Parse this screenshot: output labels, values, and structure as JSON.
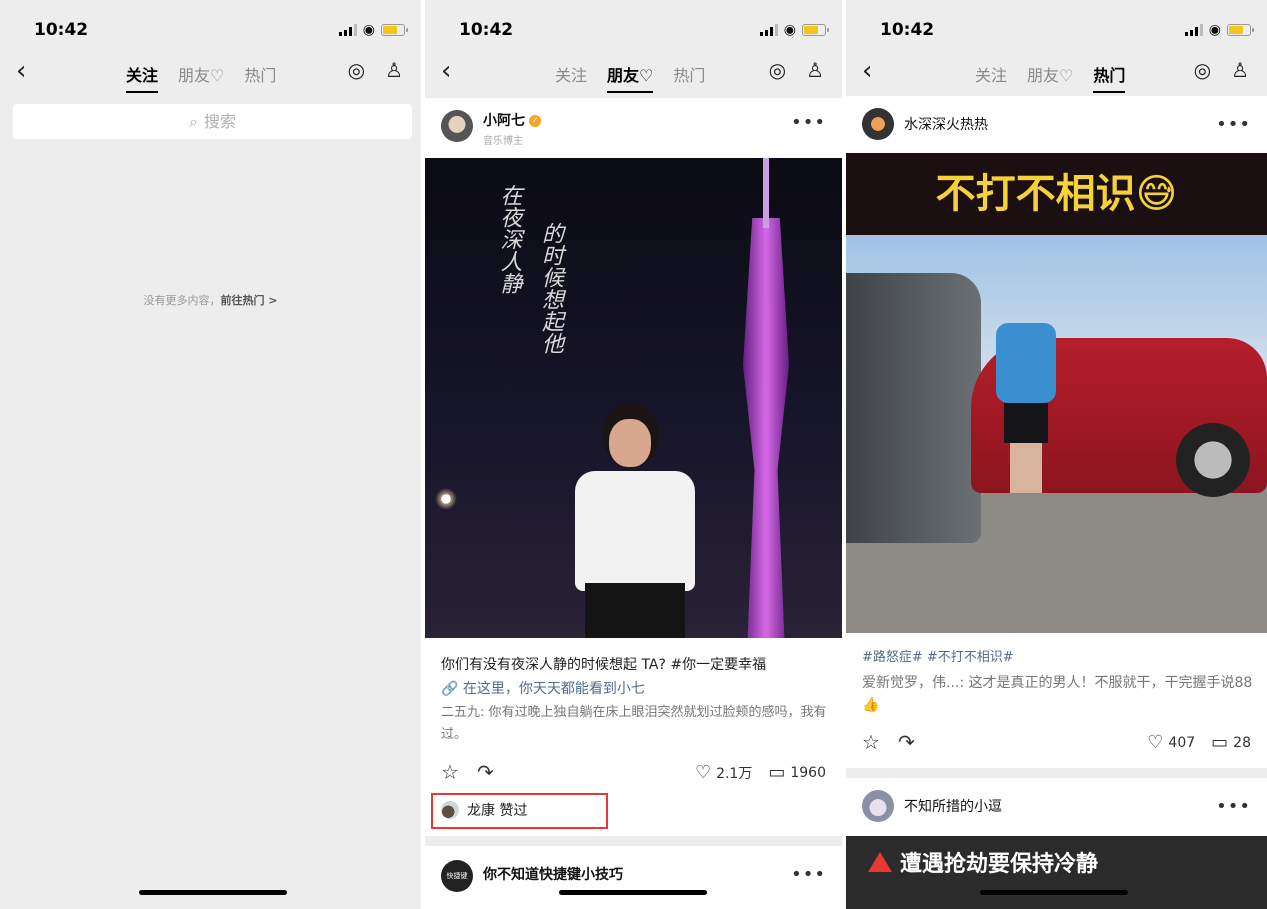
{
  "status": {
    "time": "10:42"
  },
  "nav": {
    "tabs": [
      "关注",
      "朋友♡",
      "热门"
    ]
  },
  "panel1": {
    "search_placeholder": "搜索",
    "empty_text": "没有更多内容，",
    "empty_link": "前往热门 >"
  },
  "panel2": {
    "post1": {
      "author": "小阿七",
      "author_sub": "音乐博主",
      "overlay_text": [
        "在夜深人静",
        "的时候想起他"
      ],
      "caption": "你们有没有夜深人静的时候想起 TA? #你一定要幸福",
      "link": "在这里，你天天都能看到小七",
      "comment": "二五九: 你有过晚上独自躺在床上眼泪突然就划过脸颊的感吗，我有过。",
      "likes": "2.1万",
      "comments": "1960",
      "liked_by": "龙康 赞过"
    },
    "post2": {
      "author": "你不知道快捷键小技巧",
      "avatar_text": "快捷键"
    }
  },
  "panel3": {
    "post1": {
      "author": "水深深火热热",
      "banner": "不打不相识😅",
      "hashtags": "#路怒症#  #不打不相识#",
      "comment": "爱新觉罗，伟...: 这才是真正的男人！不服就干，干完握手说88👍",
      "likes": "407",
      "comments": "28"
    },
    "post2": {
      "author": "不知所措的小逗",
      "banner": "遭遇抢劫要保持冷静"
    }
  },
  "colors": {
    "verified": "#f5a623",
    "highlight_box": "#e53935",
    "link": "#536b8f",
    "battery": "#f4c51b"
  }
}
